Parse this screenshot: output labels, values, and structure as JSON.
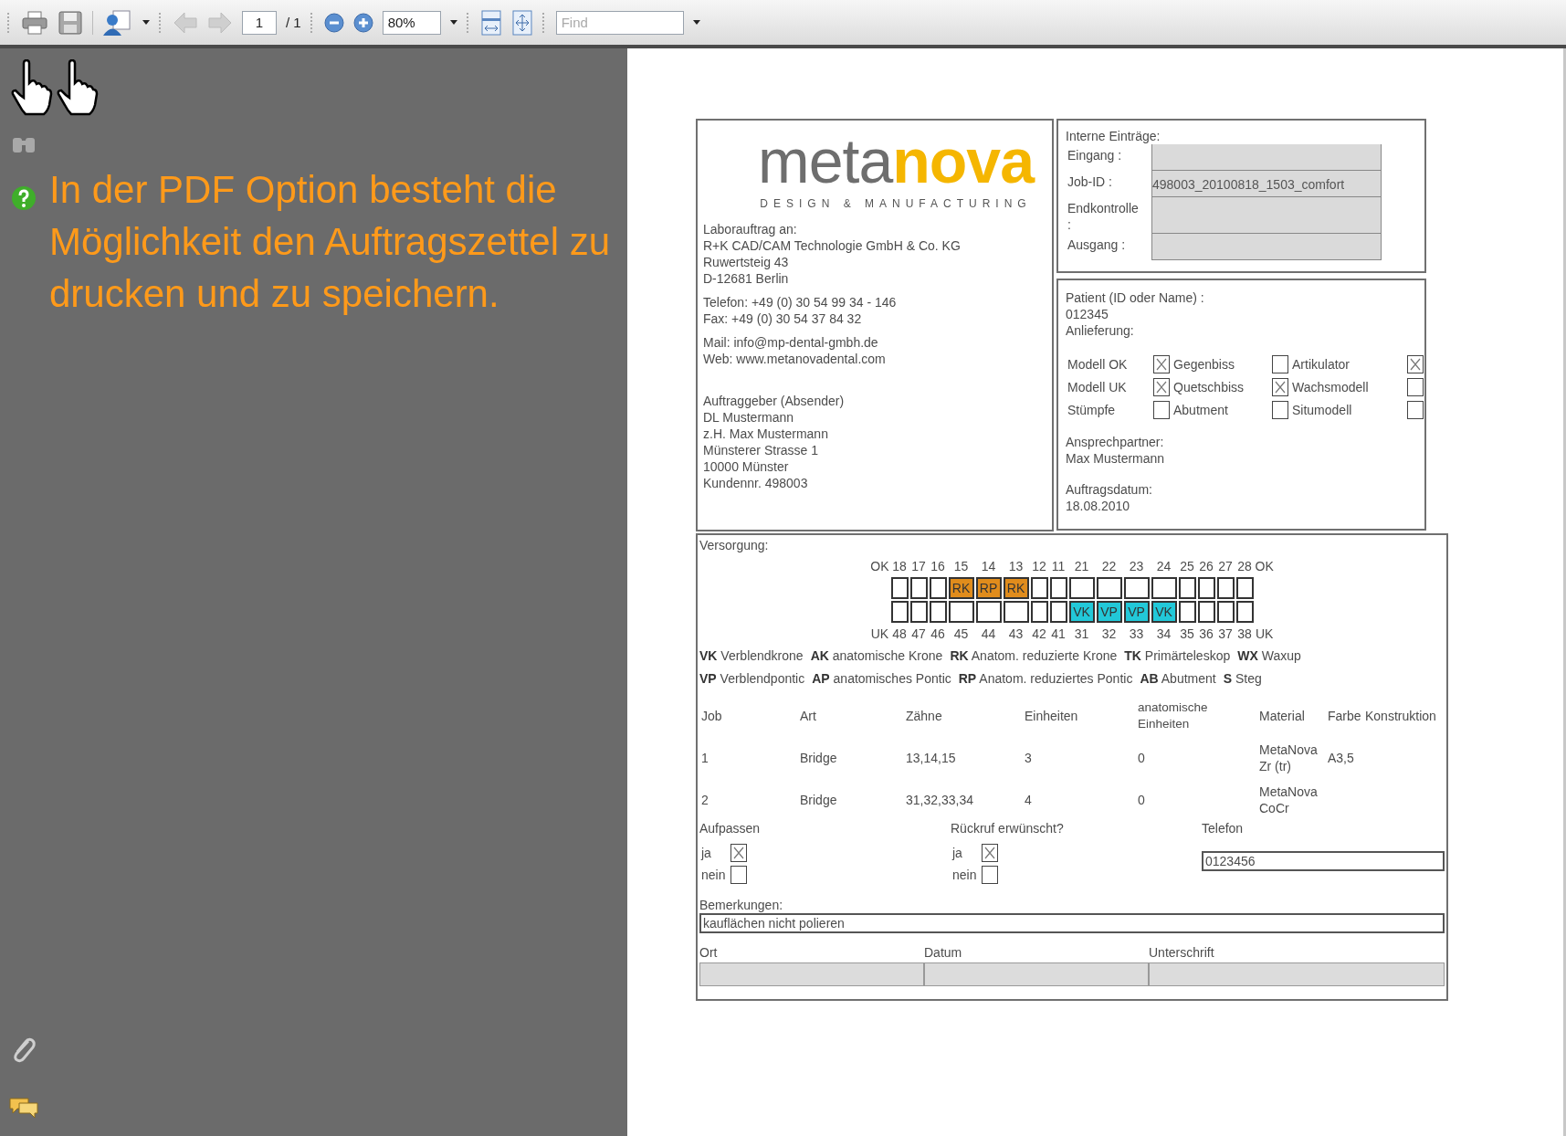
{
  "toolbar": {
    "page_field": "1",
    "page_total": "/ 1",
    "zoom_field": "80%",
    "find": {
      "placeholder": "Find"
    }
  },
  "side_note": "In der PDF Option besteht die Möglichkeit den Auftragszettel zu drucken und zu speichern.",
  "form": {
    "logo": {
      "part_1": "meta",
      "part_2": "nova",
      "tagline": "DESIGN & MANUFACTURING"
    },
    "address_blocks": [
      [
        "Laborauftrag an:",
        "R+K CAD/CAM Technologie GmbH & Co. KG",
        "Ruwertsteig 43",
        "D-12681 Berlin"
      ],
      [
        "Telefon: +49 (0) 30 54 99 34 - 146",
        "Fax: +49 (0) 30 54 37 84 32"
      ],
      [
        "Mail: info@mp-dental-gmbh.de",
        "Web: www.metanovadental.com"
      ],
      [
        "Auftraggeber (Absender)",
        "DL Mustermann",
        "z.H. Max Mustermann",
        "Münsterer Strasse 1",
        "10000 Münster",
        "Kundennr. 498003"
      ]
    ],
    "internal": {
      "title": "Interne Einträge:",
      "fields": [
        {
          "label": "Eingang :"
        },
        {
          "label": "Job-ID :",
          "value": "498003_20100818_1503_comfort"
        },
        {
          "label": "Endkontrolle :"
        },
        {
          "label": "Ausgang :"
        }
      ]
    },
    "patient": {
      "label": "Patient (ID oder Name) :",
      "value": "012345",
      "delivery_label": "Anlieferung:",
      "delivery": [
        [
          {
            "label": "Modell OK",
            "checked": true
          },
          {
            "label": "Gegenbiss",
            "checked": false
          },
          {
            "label": "Artikulator",
            "checked": true
          }
        ],
        [
          {
            "label": "Modell UK",
            "checked": true
          },
          {
            "label": "Quetschbiss",
            "checked": true
          },
          {
            "label": "Wachsmodell",
            "checked": false
          }
        ],
        [
          {
            "label": "Stümpfe",
            "checked": false
          },
          {
            "label": "Abutment",
            "checked": false
          },
          {
            "label": "Situmodell",
            "checked": false
          }
        ]
      ],
      "contact_label": "Ansprechpartner:",
      "contact": "Max Mustermann",
      "date_label": "Auftragsdatum:",
      "date": "18.08.2010"
    },
    "versorgung": {
      "title": "Versorgung:",
      "upper_left": "OK",
      "upper_right": "OK",
      "lower_left": "UK",
      "lower_right": "UK",
      "columns": [
        {
          "upper": "18",
          "lower": "48"
        },
        {
          "upper": "17",
          "lower": "47"
        },
        {
          "upper": "16",
          "lower": "46"
        },
        {
          "upper": "15",
          "lower": "45",
          "upper_mark": {
            "code": "RK",
            "color": "#e08c1c"
          }
        },
        {
          "upper": "14",
          "lower": "44",
          "upper_mark": {
            "code": "RP",
            "color": "#e08c1c"
          }
        },
        {
          "upper": "13",
          "lower": "43",
          "upper_mark": {
            "code": "RK",
            "color": "#e08c1c"
          }
        },
        {
          "upper": "12",
          "lower": "42"
        },
        {
          "upper": "11",
          "lower": "41"
        },
        {
          "upper": "21",
          "lower": "31",
          "lower_mark": {
            "code": "VK",
            "color": "#22c8d8"
          }
        },
        {
          "upper": "22",
          "lower": "32",
          "lower_mark": {
            "code": "VP",
            "color": "#22c8d8"
          }
        },
        {
          "upper": "23",
          "lower": "33",
          "lower_mark": {
            "code": "VP",
            "color": "#22c8d8"
          }
        },
        {
          "upper": "24",
          "lower": "34",
          "lower_mark": {
            "code": "VK",
            "color": "#22c8d8"
          }
        },
        {
          "upper": "25",
          "lower": "35"
        },
        {
          "upper": "26",
          "lower": "36"
        },
        {
          "upper": "27",
          "lower": "37"
        },
        {
          "upper": "28",
          "lower": "38"
        }
      ],
      "legend": [
        [
          "**VK** Verblendkrone",
          "**AK** anatomische Krone",
          "**RK** Anatom. reduzierte Krone",
          "**TK** Primärteleskop",
          "**WX** Waxup"
        ],
        [
          "**VP** Verblendpontic",
          "**AP** anatomisches Pontic",
          "**RP** Anatom. reduziertes Pontic",
          "**AB** Abutment",
          "**S** Steg"
        ]
      ]
    },
    "jobs": {
      "columns": [
        "Job",
        "Art",
        "Zähne",
        "Einheiten",
        "anatomische Einheiten",
        "Material",
        "Farbe",
        "Konstruktion"
      ],
      "rows": [
        {
          "job": "1",
          "art": "Bridge",
          "teeth": "13,14,15",
          "units": "3",
          "anatomic_units": "0",
          "material": "MetaNova Zr (tr)",
          "shade": "A3,5"
        },
        {
          "job": "2",
          "art": "Bridge",
          "teeth": "31,32,33,34",
          "units": "4",
          "anatomic_units": "0",
          "material": "MetaNova CoCr"
        }
      ]
    },
    "care": {
      "label": "Aufpassen",
      "options": [
        {
          "label": "ja",
          "checked": true
        },
        {
          "label": "nein",
          "checked": false
        }
      ]
    },
    "callback": {
      "label": "Rückruf erwünscht?",
      "options": [
        {
          "label": "ja",
          "checked": true
        },
        {
          "label": "nein",
          "checked": false
        }
      ]
    },
    "phone": {
      "label": "Telefon",
      "value": "0123456"
    },
    "remarks": {
      "label": "Bemerkungen:",
      "value": "kauflächen nicht polieren"
    },
    "signature": [
      {
        "label": "Ort"
      },
      {
        "label": "Datum"
      },
      {
        "label": "Unterschrift"
      }
    ]
  }
}
